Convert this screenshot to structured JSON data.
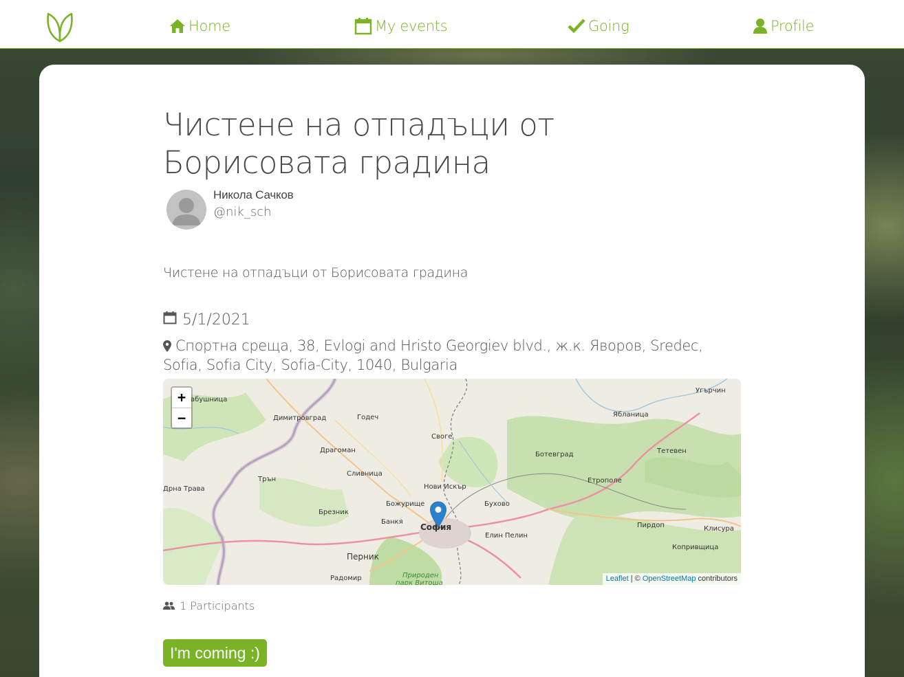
{
  "nav": {
    "items": [
      {
        "label": "Home",
        "icon": "home-icon"
      },
      {
        "label": "My events",
        "icon": "calendar-icon"
      },
      {
        "label": "Going",
        "icon": "checkmark-icon"
      },
      {
        "label": "Profile",
        "icon": "user-icon"
      }
    ],
    "logo_icon": "leaf-logo-icon"
  },
  "event": {
    "title": "Чистене на отпадъци от Борисовата градина",
    "author_name": "Никола Сачков",
    "author_handle": "@nik_sch",
    "description": "Чистене на отпадъци от Борисовата градина",
    "date": "5/1/2021",
    "address": "Спортна среща, 38, Evlogi and Hristo Georgiev blvd., ж.к. Яворов, Sredec, Sofia, Sofia City, Sofia-City, 1040, Bulgaria",
    "participants": "1 Participants",
    "cta_label": "I'm coming :)"
  },
  "map": {
    "zoom_in": "+",
    "zoom_out": "−",
    "attribution_leaflet": "Leaflet",
    "attribution_sep": " | © ",
    "attribution_osm": "OpenStreetMap",
    "attribution_suffix": " contributors",
    "places": [
      "абушница",
      "Димитровград",
      "Годеч",
      "Своге",
      "Драгоман",
      "Ботевград",
      "Угърчин",
      "Ябланица",
      "Тетевен",
      "Етрополе",
      "Трън",
      "Сливница",
      "Нови Искър",
      "Дрна Трава",
      "Брезник",
      "Бухово",
      "Божурище",
      "Банкя",
      "София",
      "Елин Пелин",
      "Пирдоп",
      "Клисура",
      "Копривщица",
      "Перник",
      "Радомир",
      "Природен",
      "парк Витоша"
    ]
  },
  "colors": {
    "accent": "#7ab228",
    "title_text": "#474747",
    "body_text": "#555555",
    "card": "#ffffff"
  }
}
